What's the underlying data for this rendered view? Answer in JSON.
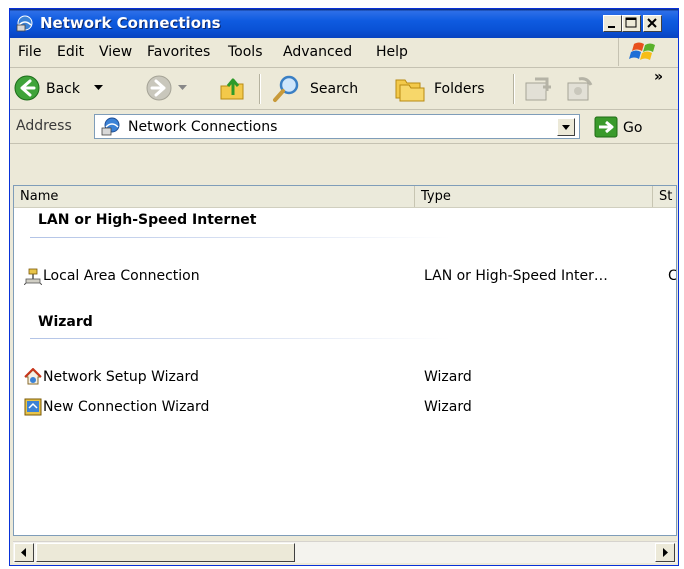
{
  "window": {
    "title": "Network Connections"
  },
  "menubar": {
    "items": [
      "File",
      "Edit",
      "View",
      "Favorites",
      "Tools",
      "Advanced",
      "Help"
    ]
  },
  "toolbar": {
    "back_label": "Back",
    "search_label": "Search",
    "folders_label": "Folders",
    "overflow_label": "»"
  },
  "address": {
    "label": "Address",
    "value": "Network Connections",
    "go_label": "Go"
  },
  "list": {
    "columns": [
      "Name",
      "Type",
      "St"
    ],
    "groups": [
      {
        "title": "LAN or High-Speed Internet",
        "items": [
          {
            "name": "Local Area Connection",
            "type": "LAN or High-Speed Inter…",
            "extra": "C",
            "icon": "network-connection-icon"
          }
        ]
      },
      {
        "title": "Wizard",
        "items": [
          {
            "name": "Network Setup Wizard",
            "type": "Wizard",
            "icon": "network-setup-wizard-icon"
          },
          {
            "name": "New Connection Wizard",
            "type": "Wizard",
            "icon": "new-connection-wizard-icon"
          }
        ]
      }
    ]
  },
  "colors": {
    "titlebar": "#0a52d6",
    "chrome": "#ece9d8",
    "group_line": "#b2c3e6",
    "go_arrow": "#3a9a2b"
  }
}
